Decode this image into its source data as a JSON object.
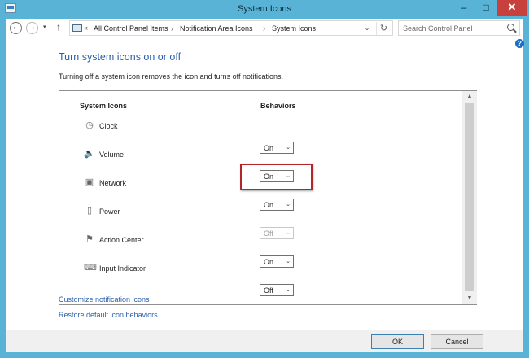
{
  "window": {
    "title": "System Icons",
    "minimize": "–",
    "maximize": "□",
    "close": "✕"
  },
  "nav": {
    "back": "←",
    "forward": "→",
    "recent": "▾",
    "up": "↑",
    "overflow": "«",
    "breadcrumbs": [
      "All Control Panel Items",
      "Notification Area Icons",
      "System Icons"
    ],
    "separator": "›",
    "address_dropdown": "⌄",
    "refresh": "↻",
    "search_placeholder": "Search Control Panel"
  },
  "help": "?",
  "page": {
    "heading": "Turn system icons on or off",
    "description": "Turning off a system icon removes the icon and turns off notifications."
  },
  "table": {
    "headers": {
      "icons": "System Icons",
      "behaviors": "Behaviors"
    },
    "rows": [
      {
        "name": "Clock",
        "icon": "clock-icon",
        "glyph": "◷",
        "value": "On",
        "enabled": true
      },
      {
        "name": "Volume",
        "icon": "speaker-icon",
        "glyph": "🔈",
        "value": "On",
        "enabled": true
      },
      {
        "name": "Network",
        "icon": "network-icon",
        "glyph": "▣",
        "value": "On",
        "enabled": true
      },
      {
        "name": "Power",
        "icon": "battery-icon",
        "glyph": "▯",
        "value": "Off",
        "enabled": false
      },
      {
        "name": "Action Center",
        "icon": "flag-icon",
        "glyph": "⚑",
        "value": "On",
        "enabled": true
      },
      {
        "name": "Input Indicator",
        "icon": "keyboard-icon",
        "glyph": "⌨",
        "value": "Off",
        "enabled": true
      }
    ],
    "dropdown_arrow": "⌄",
    "scroll_up": "▲",
    "scroll_down": "▼"
  },
  "links": {
    "customize": "Customize notification icons",
    "restore": "Restore default icon behaviors"
  },
  "footer": {
    "ok": "OK",
    "cancel": "Cancel"
  },
  "colors": {
    "titlebar": "#58b3d6",
    "link": "#2b5fa9",
    "highlight_border": "#b3242b",
    "close_button": "#c7403b"
  }
}
